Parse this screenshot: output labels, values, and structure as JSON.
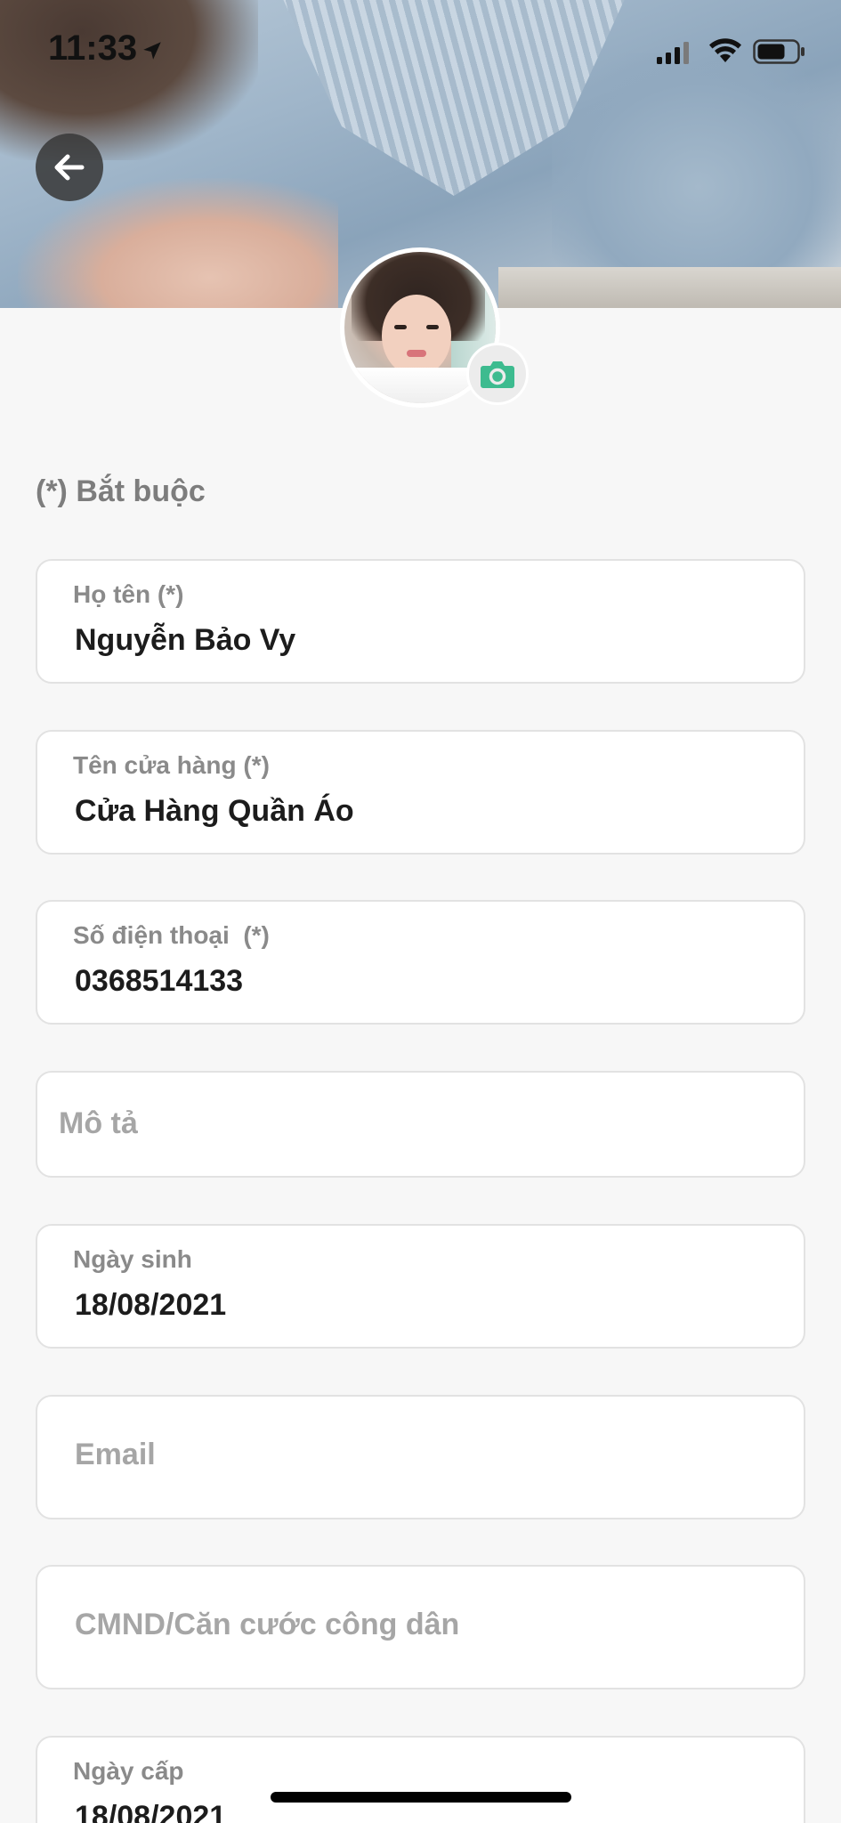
{
  "status_bar": {
    "time": "11:33"
  },
  "icons": {
    "back": "arrow-left-icon",
    "camera": "camera-icon",
    "location": "location-arrow-icon",
    "signal": "cellular-signal-icon",
    "wifi": "wifi-icon",
    "battery": "battery-icon"
  },
  "colors": {
    "accent": "#3dbb8f",
    "background": "#f7f7f7",
    "label": "#8a8a8a",
    "value": "#1c1c1c"
  },
  "form": {
    "required_note": "(*) Bắt buộc",
    "full_name": {
      "label": "Họ tên (*)",
      "value": "Nguyễn Bảo Vy"
    },
    "store_name": {
      "label": "Tên cửa hàng (*)",
      "value": "Cửa Hàng Quần Áo"
    },
    "phone": {
      "label": "Số điện thoại  (*)",
      "value": "0368514133"
    },
    "description": {
      "placeholder": "Mô tả"
    },
    "birthday": {
      "label": "Ngày sinh",
      "value": "18/08/2021"
    },
    "email": {
      "placeholder": "Email"
    },
    "id_card": {
      "placeholder": "CMND/Căn cước công dân"
    },
    "issue_date": {
      "label": "Ngày cấp",
      "value": "18/08/2021"
    }
  }
}
